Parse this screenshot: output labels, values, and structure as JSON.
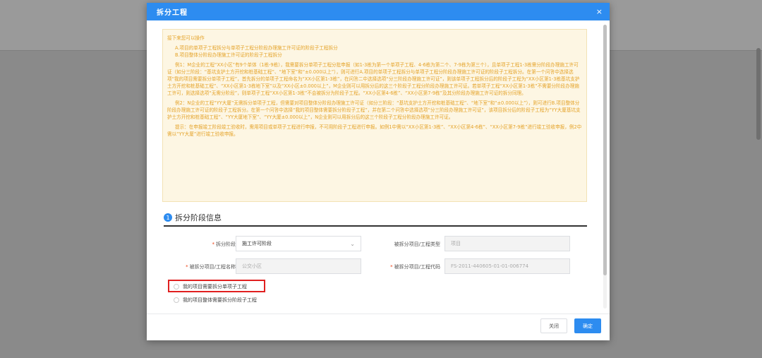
{
  "dialog": {
    "title": "拆分工程",
    "close_glyph": "×"
  },
  "notice": {
    "intro": "接下来您可以操作",
    "option_a": "A.项目的单项子工程拆分与单项子工程分阶段办理施工许可证的阶段子工程拆分",
    "option_b": "B.项目整体分阶段办理施工许可证的阶段子工程拆分",
    "example1": "例1：M企业的工程“XX小区”有9个单体（1栋-9栋），我需要拆分单项子工程分批申报（如1-3栋为第一个单项子工程、4-6栋为第二个、7-9栋为第三个），且单项子工程1-3栋需分阶段办理施工许可证（如分三阶段：“基坑支护土方开挖和桩基础工程”、“地下室”和“±0.000以上”），则可进行A.项目的单项子工程拆分与单项子工程分阶段办理施工许可证的阶段子工程拆分。在第一个问答中选择选项“我的项目需要拆分单项子工程”，首先拆分的单项子工程命名为“XX小区第1-3栋”，在问答二中选择选项“分三阶段办理施工许可证”，则该单项子工程拆分后的阶段子工程为“XX小区第1-3栋基坑支护土方开挖和桩基础工程”、“XX小区第1-3栋地下室”以及“XX小区±0.000以上”，M企业则可以用拆分后的这三个阶段子工程分阶段办理施工许可证。若单项子工程“XX小区第1-3栋”不需要分阶段办理施工许可，则选择选项“无需分阶段”，则单项子工程“XX小区第1-3栋”不会被拆分为阶段子工程。“XX小区第4-6栋”、“XX小区第7-9栋”及其分阶段办理施工许可证的拆分同理。",
    "example2": "例2：N企业的工程“YY大厦”无需拆分单项子工程，但需要对项目整体分阶段办理施工许可证（如分三阶段：“基坑支护土方开挖和桩基础工程”、“地下室”和“±0.000以上”），则可进行B.项目整体分阶段办理施工许可证的阶段子工程拆分。在第一个问答中选择“我的项目整体需要拆分阶段子工程”，并在第二个问答中选择选项“分三阶段办理施工许可证”，该项目拆分后的阶段子工程为“YY大厦基坑支护土方开挖和桩基础工程”、“YY大厦地下室”、“YY大厦±0.000以上”，N企业则可以用拆分后的这三个阶段子工程分阶段办理施工许可证。",
    "tip": "提示：在申报竣工阶段竣工验收时，需用项目或单项子工程进行申报，不可用阶段子工程进行申报。如例1中需以“XX小区第1-3栋”、“XX小区第4-6栋”、“XX小区第7-9栋”进行竣工验收申报，例2中需以“YY大厦”进行竣工验收申报。"
  },
  "section": {
    "number": "1",
    "title": "拆分阶段信息"
  },
  "form": {
    "required_mark": "*",
    "stage_label": "拆分阶段",
    "stage_value": "施工许可阶段",
    "type_label": "被拆分项目/工程类型",
    "type_value": "项目",
    "name_label": "被拆分项目/工程名称",
    "name_value": "公交小区",
    "code_label": "被拆分项目/工程代码",
    "code_value": "FS-2011-440605-01-01-006774"
  },
  "radios": {
    "option1": "我的项目需要拆分单项子工程",
    "option2": "我的项目整体需要拆分阶段子工程"
  },
  "footer": {
    "close_label": "关闭",
    "ok_label": "确定"
  },
  "colors": {
    "primary": "#2d8cf0",
    "notice_text": "#e4a227",
    "notice_bg": "#fdf6e3",
    "highlight": "#e02020",
    "required": "#ed4014"
  }
}
